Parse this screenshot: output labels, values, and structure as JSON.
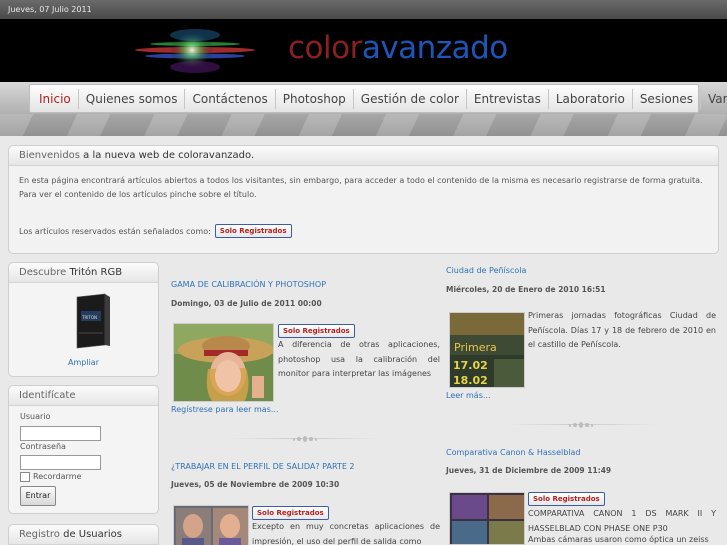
{
  "date_bar": "Jueves, 07 Julio 2011",
  "logo": {
    "part1": "color",
    "part2": "avanzado"
  },
  "nav": [
    "Inicio",
    "Quienes somos",
    "Contáctenos",
    "Photoshop",
    "Gestión de color",
    "Entrevistas",
    "Laboratorio",
    "Sesiones",
    "Varios"
  ],
  "welcome": {
    "title_prefix": "Bienvenidos",
    "title_rest": " a la nueva web de coloravanzado.",
    "paragraph": "En esta página encontrará artículos abiertos a todos los visitantes, sin embargo, para acceder a todo el contenido de la misma es necesario registrarse de forma gratuita. Para ver el contenido de los artículos pinche sobre el título.",
    "reserved_text": "Los artículos reservados están señalados como:"
  },
  "badge_label": "Solo Registrados",
  "sidebar": {
    "triton": {
      "title_prefix": "Descubre",
      "title_rest": " Tritón RGB",
      "link": "Ampliar"
    },
    "login": {
      "title": "Identifícate",
      "user_label": "Usuario",
      "pass_label": "Contraseña",
      "remember_label": "Recordarme",
      "button": "Entrar"
    },
    "register": {
      "title_prefix": "Registro",
      "title_rest": " de Usuarios"
    }
  },
  "articles": {
    "a1": {
      "title": "GAMA DE CALIBRACIÓN Y PHOTOSHOP",
      "date": "Domingo, 03 de Julio de 2011 00:00",
      "text": "A diferencia de otras aplicaciones, photoshop usa la calibración del monitor para interpretar las imágenes",
      "more": "Regístrese para leer mas..."
    },
    "a2": {
      "title": "¿TRABAJAR EN EL PERFIL DE SALIDA? PARTE 2",
      "date": "Jueves, 05 de Noviembre de 2009 10:30",
      "text": "Excepto en muy concretas aplicaciones de impresión, el uso del perfil de salida como"
    },
    "a3": {
      "title": "Ciudad de Peñíscola",
      "date": "Miércoles, 20 de Enero de 2010 16:51",
      "text": "Primeras jornadas fotográficas Ciudad de Peñíscola. Días 17 y 18 de febrero de 2010 en el castillo de Peñíscola.",
      "more": "Leer más...",
      "img_text1": "Primera",
      "img_text2": "17.02",
      "img_text3": "18.02"
    },
    "a4": {
      "title": "Comparativa Canon & Hasselblad",
      "date": "Jueves, 31 de Diciembre de 2009 11:49",
      "text1": "COMPARATIVA CANON 1 DS MARK II Y HASSELBLAD CON PHASE ONE P30",
      "text2": "Ambas cámaras usaron como óptica un zeiss"
    }
  }
}
